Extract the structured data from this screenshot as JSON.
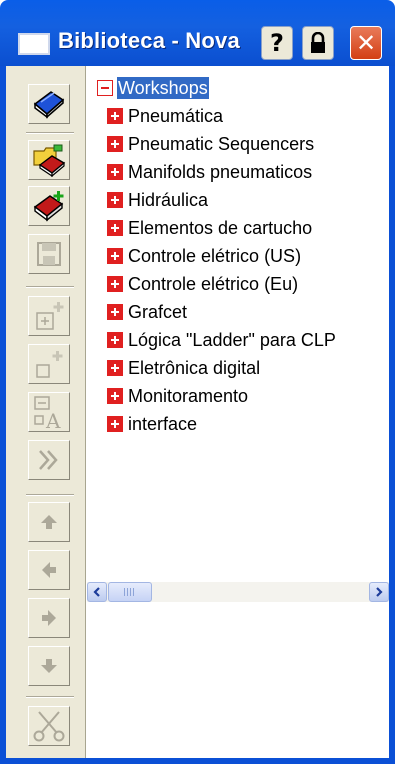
{
  "window": {
    "title": "Biblioteca - Nova",
    "help_label": "?",
    "close_label": "✕"
  },
  "toolbar": {
    "buttons": [
      {
        "name": "library-book-button",
        "icon": "blue-book-icon",
        "enabled": true
      },
      {
        "name": "open-folder-book-button",
        "icon": "folder-book-icon",
        "enabled": true
      },
      {
        "name": "new-book-button",
        "icon": "red-book-plus-icon",
        "enabled": true
      },
      {
        "name": "save-button",
        "icon": "floppy-disk-icon",
        "enabled": false
      },
      {
        "name": "add-item-button",
        "icon": "add-box-icon",
        "enabled": false
      },
      {
        "name": "new-item-button",
        "icon": "new-box-icon",
        "enabled": false
      },
      {
        "name": "rename-button",
        "icon": "rename-text-icon",
        "enabled": false
      },
      {
        "name": "forward-button",
        "icon": "double-chevron-right-icon",
        "enabled": false
      },
      {
        "name": "move-up-button",
        "icon": "arrow-up-icon",
        "enabled": false
      },
      {
        "name": "move-left-button",
        "icon": "arrow-left-icon",
        "enabled": false
      },
      {
        "name": "move-right-button",
        "icon": "arrow-right-icon",
        "enabled": false
      },
      {
        "name": "move-down-button",
        "icon": "arrow-down-icon",
        "enabled": false
      },
      {
        "name": "cut-button",
        "icon": "scissors-icon",
        "enabled": false
      }
    ]
  },
  "tree": {
    "root": {
      "label": "Workshops",
      "expanded": true,
      "selected": true
    },
    "items": [
      {
        "label": "Pneumática"
      },
      {
        "label": "Pneumatic Sequencers"
      },
      {
        "label": "Manifolds pneumaticos"
      },
      {
        "label": "Hidráulica"
      },
      {
        "label": "Elementos de cartucho"
      },
      {
        "label": "Controle elétrico (US)"
      },
      {
        "label": "Controle elétrico (Eu)"
      },
      {
        "label": "Grafcet"
      },
      {
        "label": "Lógica \"Ladder\" para CLP"
      },
      {
        "label": "Eletrônica digital"
      },
      {
        "label": "Monitoramento"
      },
      {
        "label": "interface"
      }
    ]
  },
  "colors": {
    "titlebar": "#0b50d6",
    "selection": "#316ac5",
    "expander": "#e02020",
    "toolbar": "#ece9d8"
  }
}
